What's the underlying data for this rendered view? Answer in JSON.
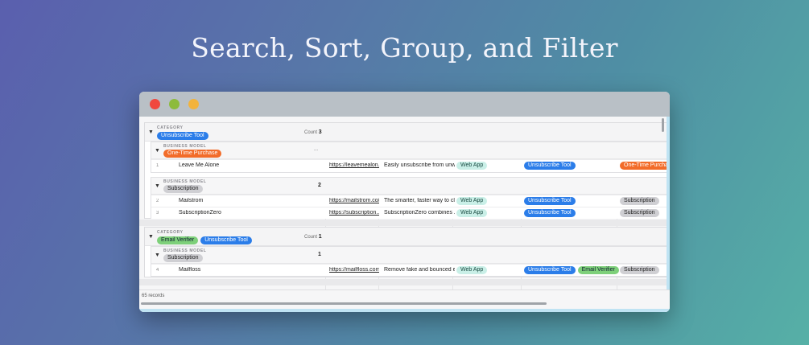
{
  "headline": "Search, Sort, Group, and Filter",
  "colors": {
    "accent_blue": "#2b7de9",
    "orange": "#f26c2a",
    "green": "#7ed07a",
    "teal": "#c9efe7"
  },
  "window": {
    "traffic_lights": [
      "close",
      "minimize",
      "zoom"
    ]
  },
  "groups": [
    {
      "caption": "CATEGORY",
      "tags": [
        "Unsubscribe Tool"
      ],
      "count_label": "Count",
      "count": "3",
      "subgroups": [
        {
          "caption": "BUSINESS MODEL",
          "tag": "One-Time Purchase",
          "count": "...",
          "rows": [
            {
              "num": "1",
              "name": "Leave Me Alone",
              "url": "https://leavemealon...",
              "desc": "Easily unsubscribe from unw...",
              "platform": "Web App",
              "categories": [
                "Unsubscribe Tool"
              ],
              "model": "One-Time Purchase"
            }
          ]
        },
        {
          "caption": "BUSINESS MODEL",
          "tag": "Subscription",
          "count": "2",
          "rows": [
            {
              "num": "2",
              "name": "Mailstrom",
              "url": "https://mailstrom.co/",
              "desc": "The smarter, faster way to cl...",
              "platform": "Web App",
              "categories": [
                "Unsubscribe Tool"
              ],
              "model": "Subscription"
            },
            {
              "num": "3",
              "name": "SubscriptionZero",
              "url": "https://subscription...",
              "desc": "SubscriptionZero combines ...",
              "platform": "Web App",
              "categories": [
                "Unsubscribe Tool"
              ],
              "model": "Subscription"
            }
          ]
        }
      ]
    },
    {
      "caption": "CATEGORY",
      "tags": [
        "Email Verifier",
        "Unsubscribe Tool"
      ],
      "count_label": "Count",
      "count": "1",
      "subgroups": [
        {
          "caption": "BUSINESS MODEL",
          "tag": "Subscription",
          "count": "1",
          "rows": [
            {
              "num": "4",
              "name": "Mailfloss",
              "url": "https://mailfloss.com/",
              "desc": "Remove fake and bounced e...",
              "platform": "Web App",
              "categories": [
                "Unsubscribe Tool",
                "Email Verifier"
              ],
              "model": "Subscription"
            }
          ]
        }
      ]
    }
  ],
  "status": {
    "records": "65 records"
  }
}
